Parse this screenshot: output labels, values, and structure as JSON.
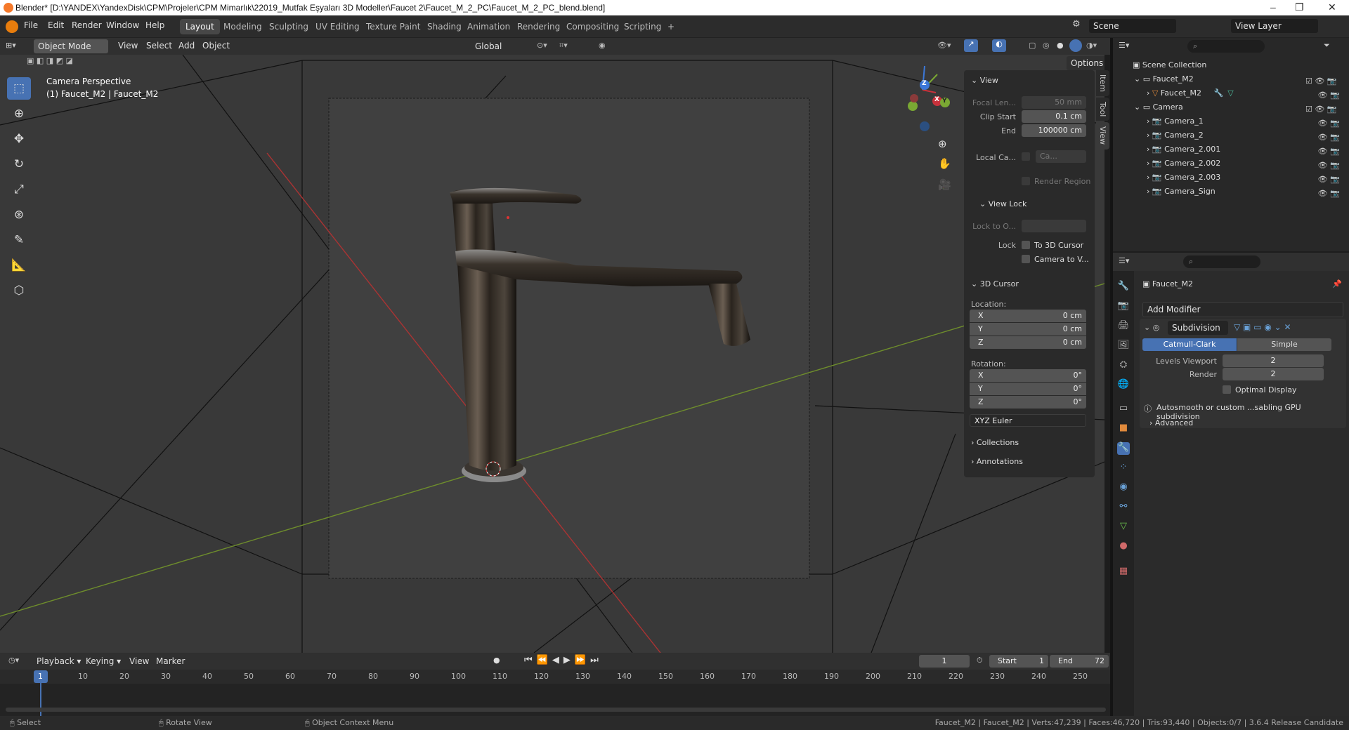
{
  "titlebar": {
    "text": "Blender* [D:\\YANDEX\\YandexDisk\\CPM\\Projeler\\CPM Mimarlık\\22019_Mutfak Eşyaları 3D Modeller\\Faucet 2\\Faucet_M_2_PC\\Faucet_M_2_PC_blend.blend]",
    "minimize": "–",
    "maximize": "❐",
    "close": "✕"
  },
  "menu": [
    "File",
    "Edit",
    "Render",
    "Window",
    "Help"
  ],
  "workspaces": [
    "Layout",
    "Modeling",
    "Sculpting",
    "UV Editing",
    "Texture Paint",
    "Shading",
    "Animation",
    "Rendering",
    "Compositing",
    "Scripting",
    "+"
  ],
  "scene": {
    "label": "Scene",
    "view_layer": "View Layer"
  },
  "header3d": {
    "mode": "Object Mode",
    "view": "View",
    "select": "Select",
    "add": "Add",
    "object": "Object",
    "orientation": "Global",
    "options": "Options"
  },
  "overlay_text": {
    "line1": "Camera Perspective",
    "line2": "(1) Faucet_M2 | Faucet_M2"
  },
  "npanel": {
    "tabs": [
      "Item",
      "Tool",
      "View"
    ],
    "view_section": "View",
    "focal_label": "Focal Len...",
    "focal_value": "50 mm",
    "clip_start_label": "Clip Start",
    "clip_start": "0.1 cm",
    "clip_end_label": "End",
    "clip_end": "100000 cm",
    "local_cam_label": "Local Ca...",
    "local_cam_value": "Ca...",
    "render_region": "Render Region",
    "view_lock": "View Lock",
    "lock_to_label": "Lock to O...",
    "lock_label": "Lock",
    "to_cursor": "To 3D Cursor",
    "camera_to_view": "Camera to V...",
    "cursor_section": "3D Cursor",
    "location": "Location:",
    "rotation": "Rotation:",
    "x": "X",
    "y": "Y",
    "z": "Z",
    "loc_x": "0 cm",
    "loc_y": "0 cm",
    "loc_z": "0 cm",
    "rot_x": "0°",
    "rot_y": "0°",
    "rot_z": "0°",
    "euler": "XYZ Euler",
    "collections": "Collections",
    "annotations": "Annotations"
  },
  "outliner": {
    "root": "Scene Collection",
    "items": [
      "Faucet_M2",
      "Faucet_M2",
      "Camera",
      "Camera_1",
      "Camera_2",
      "Camera_2.001",
      "Camera_2.002",
      "Camera_2.003",
      "Camera_Sign"
    ]
  },
  "properties": {
    "object": "Faucet_M2",
    "add_modifier": "Add Modifier",
    "modifier": "Subdivision",
    "catmull": "Catmull-Clark",
    "simple": "Simple",
    "levels_viewport_label": "Levels Viewport",
    "levels_viewport": "2",
    "render_label": "Render",
    "render": "2",
    "optimal_display": "Optimal Display",
    "info": "Autosmooth or custom ...sabling GPU subdivision",
    "advanced": "Advanced"
  },
  "timeline": {
    "playback": "Playback",
    "keying": "Keying",
    "view": "View",
    "marker": "Marker",
    "current_frame": "1",
    "start_label": "Start",
    "start": "1",
    "end_label": "End",
    "end": "72",
    "ticks": [
      "1",
      "10",
      "20",
      "30",
      "40",
      "50",
      "60",
      "70",
      "80",
      "90",
      "100",
      "110",
      "120",
      "130",
      "140",
      "150",
      "160",
      "170",
      "180",
      "190",
      "200",
      "210",
      "220",
      "230",
      "240",
      "250"
    ]
  },
  "status": {
    "left1": "Select",
    "left2": "Rotate View",
    "left3": "Object Context Menu",
    "right": "Faucet_M2 | Faucet_M2 | Verts:47,239 | Faces:46,720 | Tris:93,440 | Objects:0/7 | 3.6.4 Release Candidate"
  },
  "gizmo": {
    "x": "X",
    "y": "Y",
    "z": "Z"
  },
  "colors": {
    "accent": "#4772b3",
    "x_axis": "#c8323c",
    "y_axis": "#7aa833",
    "z_axis": "#3c78d8"
  }
}
